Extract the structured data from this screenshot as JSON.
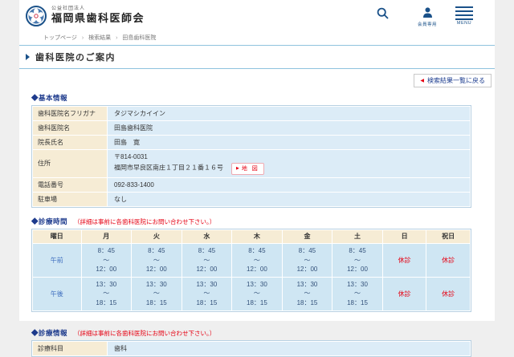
{
  "theme": {
    "navy": "#1a5189",
    "heading_navy": "#1d3a8c",
    "red": "#e60012",
    "label_beige": "#f6ecd5",
    "value_blue": "#dcecf7",
    "hours_blue": "#cfe6f3"
  },
  "header": {
    "org_type": "公益社団法人",
    "site_title": "福岡県歯科医師会",
    "member_label": "会員専用",
    "menu_label": "MENU"
  },
  "breadcrumb": {
    "separator": "›",
    "items": [
      "トップページ",
      "検索結果",
      "田島歯科医院"
    ]
  },
  "page": {
    "title": "歯科医院のご案内",
    "back_link": "検索結果一覧に戻る",
    "back_arrow": "◀"
  },
  "basic_info": {
    "heading": "◆基本情報",
    "rows": [
      {
        "label": "歯科医院名フリガナ",
        "value": "タジマシカイイン"
      },
      {
        "label": "歯科医院名",
        "value": "田島歯科医院"
      },
      {
        "label": "院長氏名",
        "value": "田島　寛"
      }
    ],
    "address": {
      "label": "住所",
      "postal": "〒814-0031",
      "street": "福岡市早良区南庄１丁目２１番１６号",
      "map_label": "地 図",
      "map_arrow": "▶"
    },
    "rows2": [
      {
        "label": "電話番号",
        "value": "092-833-1400"
      },
      {
        "label": "駐車場",
        "value": "なし"
      }
    ]
  },
  "hours": {
    "heading": "◆診療時間",
    "note": "（詳細は事前に各歯科医院にお問い合わせ下さい。）",
    "tilde": "～",
    "table": {
      "header": [
        "曜日",
        "月",
        "火",
        "水",
        "木",
        "金",
        "土",
        "日",
        "祝日"
      ],
      "rows": [
        {
          "label": "午前",
          "times": [
            {
              "start": "8：45",
              "end": "12：00"
            },
            {
              "start": "8：45",
              "end": "12：00"
            },
            {
              "start": "8：45",
              "end": "12：00"
            },
            {
              "start": "8：45",
              "end": "12：00"
            },
            {
              "start": "8：45",
              "end": "12：00"
            },
            {
              "start": "8：45",
              "end": "12：00"
            }
          ],
          "closed": [
            "休診",
            "休診"
          ]
        },
        {
          "label": "午後",
          "times": [
            {
              "start": "13：30",
              "end": "18：15"
            },
            {
              "start": "13：30",
              "end": "18：15"
            },
            {
              "start": "13：30",
              "end": "18：15"
            },
            {
              "start": "13：30",
              "end": "18：15"
            },
            {
              "start": "13：30",
              "end": "18：15"
            },
            {
              "start": "13：30",
              "end": "18：15"
            }
          ],
          "closed": [
            "休診",
            "休診"
          ]
        }
      ]
    }
  },
  "clinic_info": {
    "heading": "◆診療情報",
    "note": "（詳細は事前に各歯科医院にお問い合わせ下さい。）",
    "rows": [
      {
        "label": "診療科目",
        "value": "歯科"
      }
    ]
  }
}
